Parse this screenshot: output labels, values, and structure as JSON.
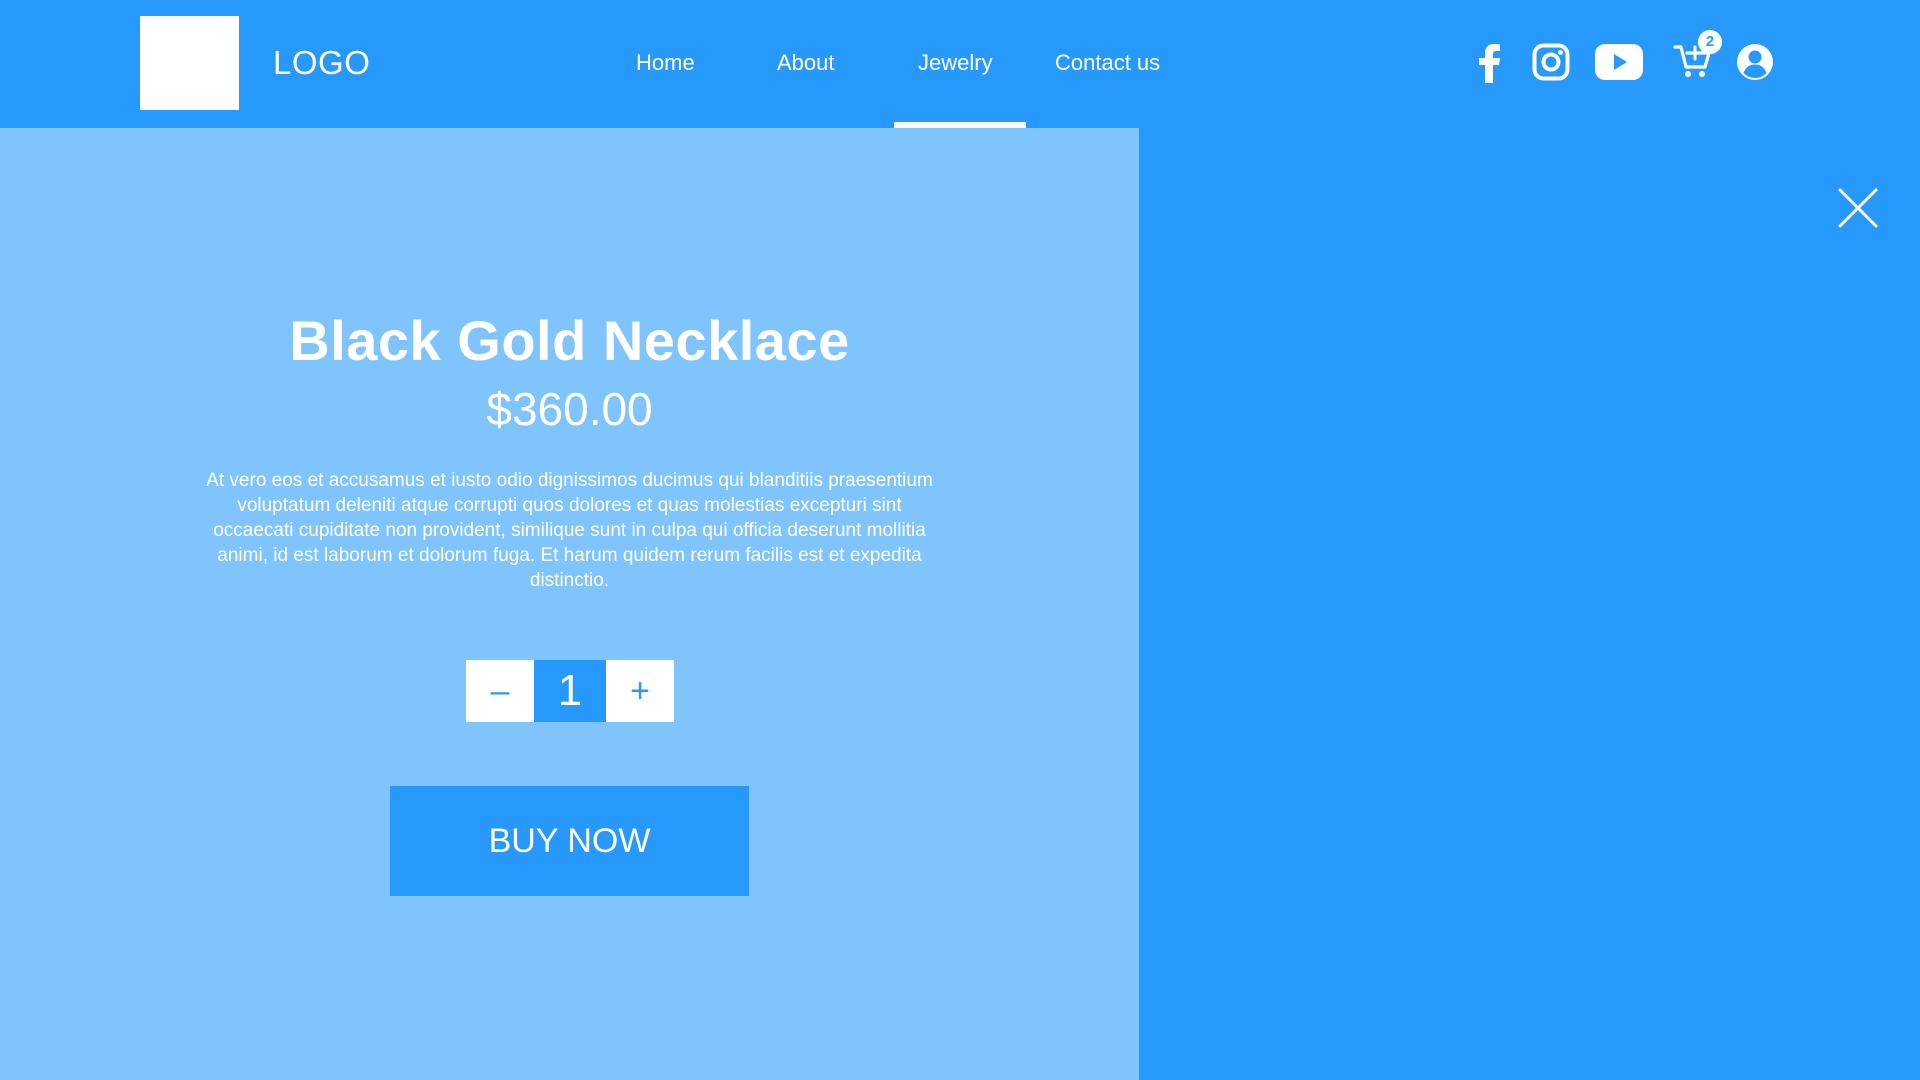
{
  "header": {
    "logo_text": "LOGO",
    "nav": [
      {
        "label": "Home"
      },
      {
        "label": "About"
      },
      {
        "label": "Jewelry",
        "active": true
      },
      {
        "label": "Contact us"
      }
    ],
    "icons": [
      "facebook-icon",
      "instagram-icon",
      "youtube-icon",
      "cart-icon",
      "user-icon"
    ],
    "cart_count": "2"
  },
  "product": {
    "title": "Black Gold Necklace",
    "price": "$360.00",
    "description": "At vero eos et accusamus et iusto odio dignissimos ducimus qui blanditiis praesentium voluptatum deleniti atque corrupti quos dolores et quas molestias excepturi sint occaecati cupiditate non provident, similique sunt in culpa qui officia deserunt mollitia animi, id est laborum et dolorum fuga. Et harum quidem rerum facilis est et expedita distinctio.",
    "quantity": {
      "minus_label": "–",
      "value": "1",
      "plus_label": "+"
    },
    "buy_label": "BUY NOW"
  },
  "colors": {
    "primary": "#2799fa",
    "panel": "#80c4fe",
    "white": "#ffffff"
  }
}
